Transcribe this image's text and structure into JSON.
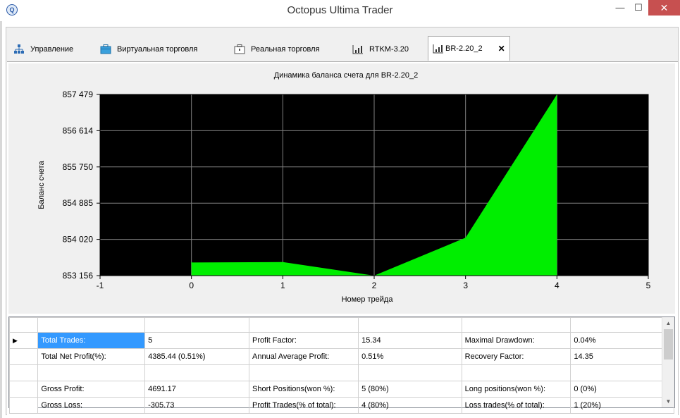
{
  "window": {
    "title": "Octopus Ultima Trader",
    "icon": "app-logo-icon",
    "controls": {
      "minimize": "—",
      "maximize": "☐",
      "close": "✕"
    },
    "close_color": "#c75050"
  },
  "tabs": [
    {
      "label": "Управление",
      "icon": "network-icon"
    },
    {
      "label": "Виртуальная торговля",
      "icon": "briefcase-icon"
    },
    {
      "label": "Реальная торговля",
      "icon": "case-icon"
    },
    {
      "label": "RTKM-3.20",
      "icon": "chart-icon"
    },
    {
      "label": "BR-2.20_2",
      "icon": "chart-icon",
      "active": true,
      "close": "✕"
    }
  ],
  "chart_data": {
    "type": "area",
    "title": "Динамика баланса счета для BR-2.20_2",
    "xlabel": "Номер трейда",
    "ylabel": "Баланс счета",
    "x": [
      0,
      1,
      2,
      3,
      4
    ],
    "y": [
      853470,
      853480,
      853156,
      854060,
      857479
    ],
    "xlim": [
      -1,
      5
    ],
    "ylim": [
      853156,
      857479
    ],
    "xticks": [
      "-1",
      "0",
      "1",
      "2",
      "3",
      "4",
      "5"
    ],
    "yticks": [
      "857 479",
      "856 614",
      "855 750",
      "854 885",
      "854 020",
      "853 156"
    ],
    "plot_background": "#000000",
    "fill_color": "#00ee00",
    "grid": true
  },
  "stats": {
    "row_indicator": "▶",
    "rows": [
      [
        "Total Trades:",
        "5",
        "Profit Factor:",
        "15.34",
        "Maximal Drawdown:",
        "0.04%"
      ],
      [
        "Total Net Profit(%):",
        "4385.44 (0.51%)",
        "Annual Average Profit:",
        "0.51%",
        "Recovery Factor:",
        "14.35"
      ],
      [
        "",
        "",
        "",
        "",
        "",
        ""
      ],
      [
        "Gross Profit:",
        "4691.17",
        "Short Positions(won %):",
        "5 (80%)",
        "Long positions(won %):",
        "0 (0%)"
      ],
      [
        "Gross Loss:",
        "-305.73",
        "Profit Trades(% of total):",
        "4 (80%)",
        "Loss trades(% of total):",
        "1 (20%)"
      ]
    ],
    "selection_color": "#3399ff"
  },
  "scrollbar": {
    "up": "▲",
    "down": "▼"
  }
}
